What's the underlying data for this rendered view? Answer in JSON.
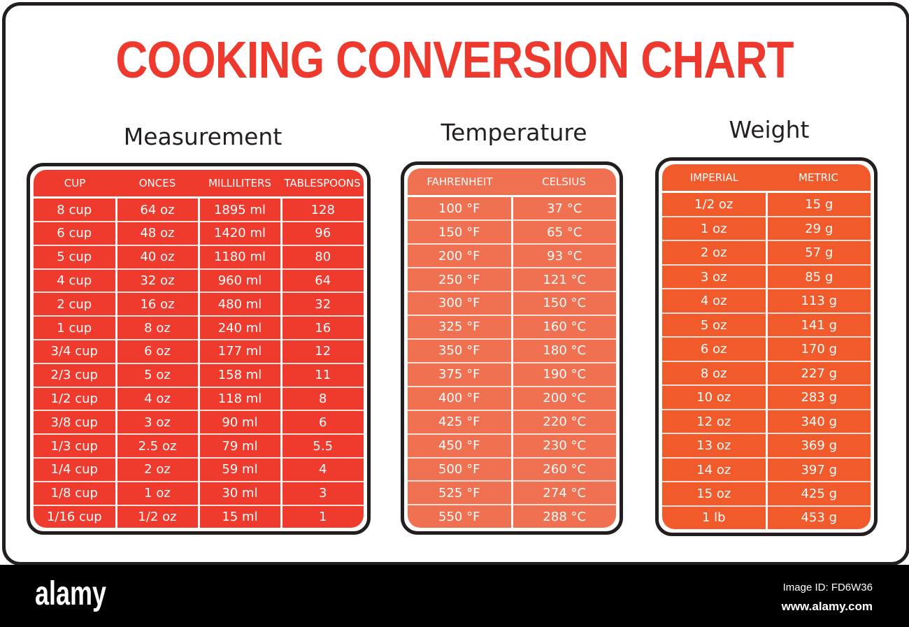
{
  "title": "COOKING CONVERSION CHART",
  "measurement": {
    "heading": "Measurement",
    "columns": [
      "CUP",
      "ONCES",
      "MILLILITERS",
      "TABLESPOONS"
    ],
    "rows": [
      [
        "8 cup",
        "64 oz",
        "1895 ml",
        "128"
      ],
      [
        "6 cup",
        "48 oz",
        "1420 ml",
        "96"
      ],
      [
        "5 cup",
        "40 oz",
        "1180 ml",
        "80"
      ],
      [
        "4 cup",
        "32 oz",
        "960 ml",
        "64"
      ],
      [
        "2 cup",
        "16 oz",
        "480 ml",
        "32"
      ],
      [
        "1 cup",
        "8 oz",
        "240 ml",
        "16"
      ],
      [
        "3/4 cup",
        "6 oz",
        "177 ml",
        "12"
      ],
      [
        "2/3 cup",
        "5 oz",
        "158 ml",
        "11"
      ],
      [
        "1/2 cup",
        "4 oz",
        "118 ml",
        "8"
      ],
      [
        "3/8 cup",
        "3 oz",
        "90 ml",
        "6"
      ],
      [
        "1/3 cup",
        "2.5 oz",
        "79 ml",
        "5.5"
      ],
      [
        "1/4 cup",
        "2 oz",
        "59 ml",
        "4"
      ],
      [
        "1/8 cup",
        "1 oz",
        "30 ml",
        "3"
      ],
      [
        "1/16 cup",
        "1/2 oz",
        "15 ml",
        "1"
      ]
    ]
  },
  "temperature": {
    "heading": "Temperature",
    "columns": [
      "FAHRENHEIT",
      "CELSIUS"
    ],
    "rows": [
      [
        "100 °F",
        "37 °C"
      ],
      [
        "150 °F",
        "65 °C"
      ],
      [
        "200 °F",
        "93 °C"
      ],
      [
        "250 °F",
        "121 °C"
      ],
      [
        "300 °F",
        "150 °C"
      ],
      [
        "325 °F",
        "160 °C"
      ],
      [
        "350 °F",
        "180 °C"
      ],
      [
        "375 °F",
        "190 °C"
      ],
      [
        "400 °F",
        "200 °C"
      ],
      [
        "425 °F",
        "220 °C"
      ],
      [
        "450 °F",
        "230 °C"
      ],
      [
        "500 °F",
        "260 °C"
      ],
      [
        "525 °F",
        "274 °C"
      ],
      [
        "550 °F",
        "288 °C"
      ]
    ]
  },
  "weight": {
    "heading": "Weight",
    "columns": [
      "IMPERIAL",
      "METRIC"
    ],
    "rows": [
      [
        "1/2 oz",
        "15 g"
      ],
      [
        "1 oz",
        "29 g"
      ],
      [
        "2 oz",
        "57 g"
      ],
      [
        "3 oz",
        "85 g"
      ],
      [
        "4 oz",
        "113 g"
      ],
      [
        "5 oz",
        "141 g"
      ],
      [
        "6 oz",
        "170 g"
      ],
      [
        "8 oz",
        "227 g"
      ],
      [
        "10 oz",
        "283 g"
      ],
      [
        "12 oz",
        "340 g"
      ],
      [
        "13 oz",
        "369 g"
      ],
      [
        "14 oz",
        "397 g"
      ],
      [
        "15 oz",
        "425 g"
      ],
      [
        "1 lb",
        "453 g"
      ]
    ]
  },
  "footer": {
    "logo": "alamy",
    "image_id": "Image ID: FD6W36",
    "url": "www.alamy.com"
  },
  "colors": {
    "title_red": "#ee3a2e",
    "measurement_bg": "#ee3b2e",
    "temperature_bg": "#f07052",
    "weight_bg": "#f15a2b"
  }
}
